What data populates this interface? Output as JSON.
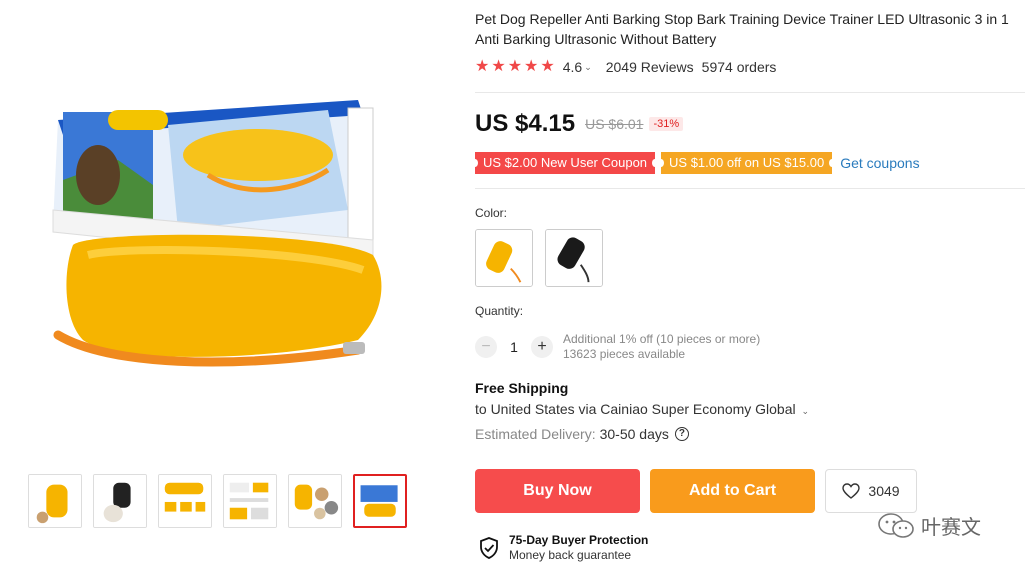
{
  "product": {
    "title_line1": "Pet Dog Repeller Anti Barking Stop Bark Training Device Trainer LED Ultrasonic 3 in 1",
    "title_line2": "Anti Barking Ultrasonic Without Battery"
  },
  "rating": {
    "value": "4.6",
    "stars": 5,
    "reviews": "2049 Reviews",
    "orders": "5974 orders"
  },
  "price": {
    "current": "US $4.15",
    "original": "US $6.01",
    "discount": "-31%"
  },
  "coupons": [
    {
      "label": "US $2.00 New User Coupon",
      "color": "#f44848"
    },
    {
      "label": "US $1.00 off on US $15.00",
      "color": "#f5a623"
    }
  ],
  "get_coupons_label": "Get coupons",
  "color_label": "Color:",
  "color_options": [
    {
      "icon": "yellow-device-icon"
    },
    {
      "icon": "black-device-icon"
    }
  ],
  "quantity": {
    "label": "Quantity:",
    "value": "1",
    "minus": "−",
    "plus": "+",
    "info_line1": "Additional 1% off (10 pieces or more)",
    "info_line2": "13623 pieces available"
  },
  "shipping": {
    "title": "Free Shipping",
    "destination": "to United States via Cainiao Super Economy Global",
    "delivery_label": "Estimated Delivery:",
    "delivery_days": "30-50 days",
    "help": "?"
  },
  "actions": {
    "buy_now": "Buy Now",
    "add_to_cart": "Add to Cart",
    "wishlist_count": "3049"
  },
  "protection": {
    "title": "75-Day Buyer Protection",
    "subtitle": "Money back guarantee"
  },
  "watermark": {
    "text": "叶赛文"
  },
  "colors": {
    "accent_red": "#f64c4c",
    "accent_orange": "#f99b1c",
    "link_blue": "#2a7bbd",
    "star_red": "#f04848"
  }
}
